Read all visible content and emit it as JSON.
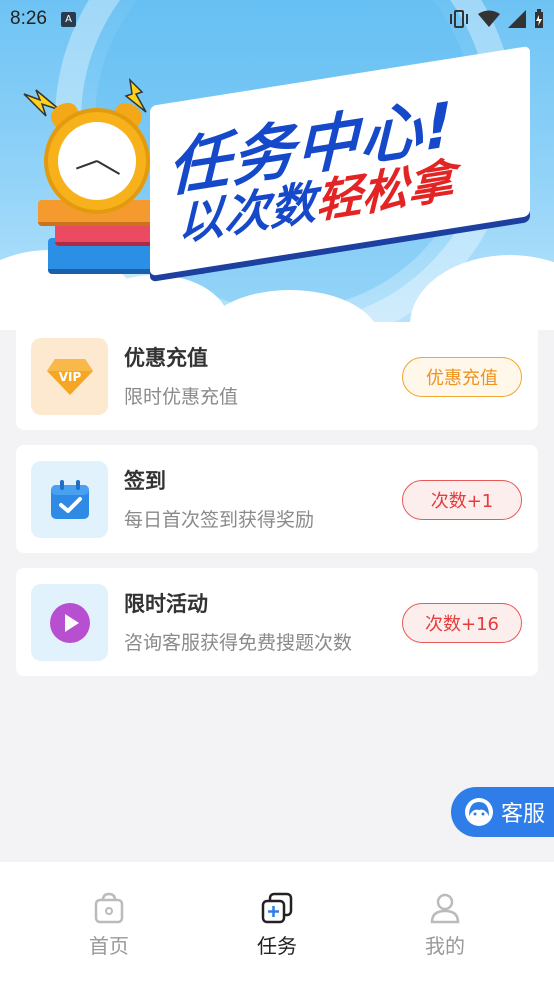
{
  "status_bar": {
    "time": "8:26",
    "a_badge": "A"
  },
  "banner": {
    "title_line1": "任务中心!",
    "title_line2_blue": "以次数",
    "title_line2_red": "轻松拿"
  },
  "tasks": [
    {
      "title": "优惠充值",
      "subtitle": "限时优惠充值",
      "button": "优惠充值",
      "icon": "vip-diamond-icon",
      "vip_text": "VIP"
    },
    {
      "title": "签到",
      "subtitle": "每日首次签到获得奖励",
      "button": "次数+1",
      "icon": "calendar-check-icon"
    },
    {
      "title": "限时活动",
      "subtitle": "咨询客服获得免费搜题次数",
      "button": "次数+16",
      "icon": "play-circle-icon"
    }
  ],
  "service": {
    "label": "客服"
  },
  "tabbar": {
    "items": [
      {
        "label": "首页",
        "icon": "home-bag-icon"
      },
      {
        "label": "任务",
        "icon": "task-add-icon"
      },
      {
        "label": "我的",
        "icon": "user-icon"
      }
    ],
    "active_index": 1
  },
  "colors": {
    "accent_blue": "#1649c9",
    "accent_red": "#e32424",
    "orange_button": "#f0921d",
    "red_button": "#e53c3c",
    "service_blue": "#2f7de8"
  }
}
